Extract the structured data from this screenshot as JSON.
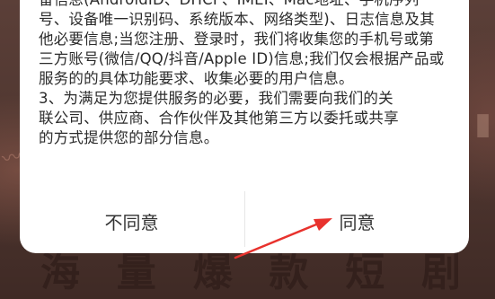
{
  "background": {
    "title": "海量爆款短剧"
  },
  "dialog": {
    "paragraph1_lines": [
      "备信息(AndroidID、DHCP、IMEI、Mac地址、手机序列",
      "号、设备唯一识别码、系统版本、网络类型)、日志信息及其",
      "他必要信息;当您注册、登录时，我们将收集您的手机号或第",
      "三方账号(微信/QQ/抖音/Apple ID)信息;我们仅会根据产品或",
      "服务的的具体功能要求、收集必要的用户信息。"
    ],
    "paragraph2_lines": [
      "3、为满足为您提供服务的必要，我们需要向我们的关",
      "联公司、供应商、合作伙伴及其他第三方以委托或共享",
      "的方式提供您的部分信息。"
    ],
    "disagree_label": "不同意",
    "agree_label": "同意"
  },
  "colors": {
    "annotation_arrow": "#e8322d",
    "dialog_bg": "#ffffff"
  }
}
